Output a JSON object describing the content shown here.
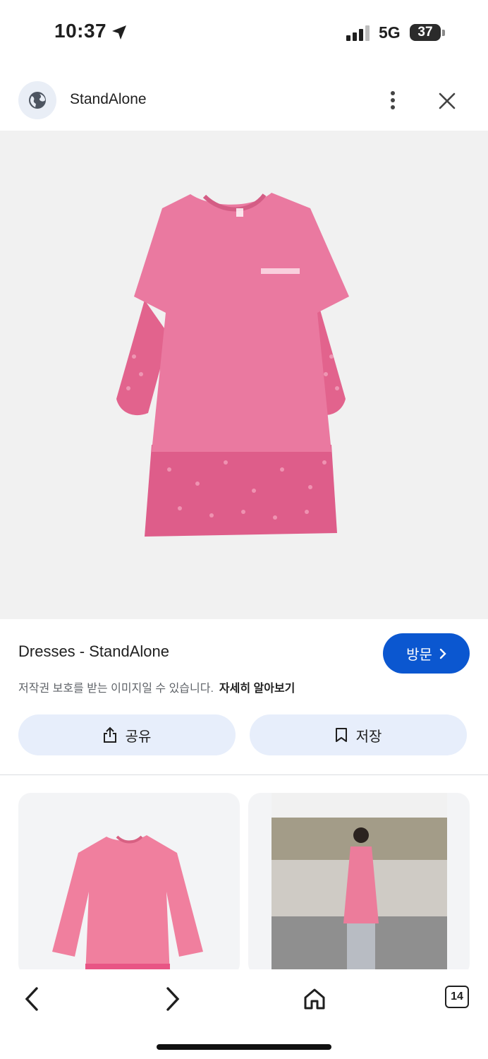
{
  "status_bar": {
    "time": "10:37",
    "network": "5G",
    "battery": "37"
  },
  "header": {
    "site_name": "StandAlone"
  },
  "result": {
    "title": "Dresses - StandAlone",
    "visit_label": "방문",
    "copyright_notice": "저작권 보호를 받는 이미지일 수 있습니다.",
    "learn_more": "자세히 알아보기",
    "share_label": "공유",
    "save_label": "저장"
  },
  "toolbar": {
    "tab_count": "14"
  },
  "colors": {
    "accent": "#0b57d0",
    "pill_bg": "#e7eefb",
    "dress_pink": "#e4668f"
  },
  "icons": [
    "location-arrow-icon",
    "signal-icon",
    "globe-icon",
    "more-vert-icon",
    "close-icon",
    "share-icon",
    "bookmark-icon",
    "back-icon",
    "forward-icon",
    "home-icon",
    "tabs-icon"
  ]
}
